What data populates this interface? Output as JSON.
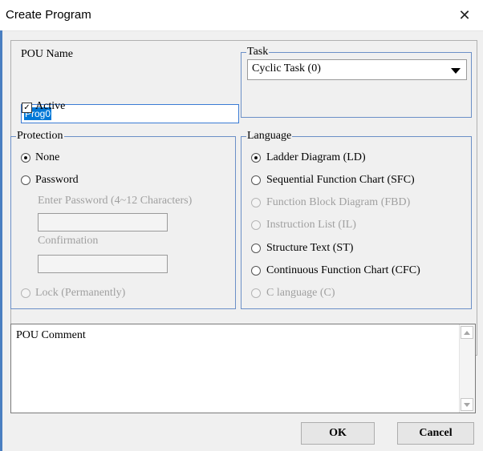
{
  "window": {
    "title": "Create Program"
  },
  "pou_name": {
    "label": "POU Name",
    "value": "Prog0"
  },
  "active": {
    "label": "Active",
    "checked": true
  },
  "task": {
    "title": "Task",
    "selected": "Cyclic Task (0)"
  },
  "protection": {
    "title": "Protection",
    "none": "None",
    "password": "Password",
    "enter_password": "Enter Password (4~12 Characters)",
    "confirmation": "Confirmation",
    "lock": "Lock (Permanently)",
    "selected": "None"
  },
  "language": {
    "title": "Language",
    "options": [
      {
        "label": "Ladder Diagram (LD)",
        "enabled": true,
        "selected": true
      },
      {
        "label": "Sequential Function Chart (SFC)",
        "enabled": true,
        "selected": false
      },
      {
        "label": "Function Block Diagram (FBD)",
        "enabled": false,
        "selected": false
      },
      {
        "label": "Instruction List (IL)",
        "enabled": false,
        "selected": false
      },
      {
        "label": "Structure Text (ST)",
        "enabled": true,
        "selected": false
      },
      {
        "label": "Continuous Function Chart (CFC)",
        "enabled": true,
        "selected": false
      },
      {
        "label": "C language (C)",
        "enabled": false,
        "selected": false
      }
    ]
  },
  "comment": {
    "text": "POU Comment"
  },
  "buttons": {
    "ok": "OK",
    "cancel": "Cancel"
  },
  "icons": {
    "close": "close-icon",
    "dropdown": "chevron-down-icon",
    "check": "check-icon"
  },
  "colors": {
    "accent": "#0078d7",
    "group_border": "#6b8fc7",
    "window_edge": "#4a7fc1"
  }
}
